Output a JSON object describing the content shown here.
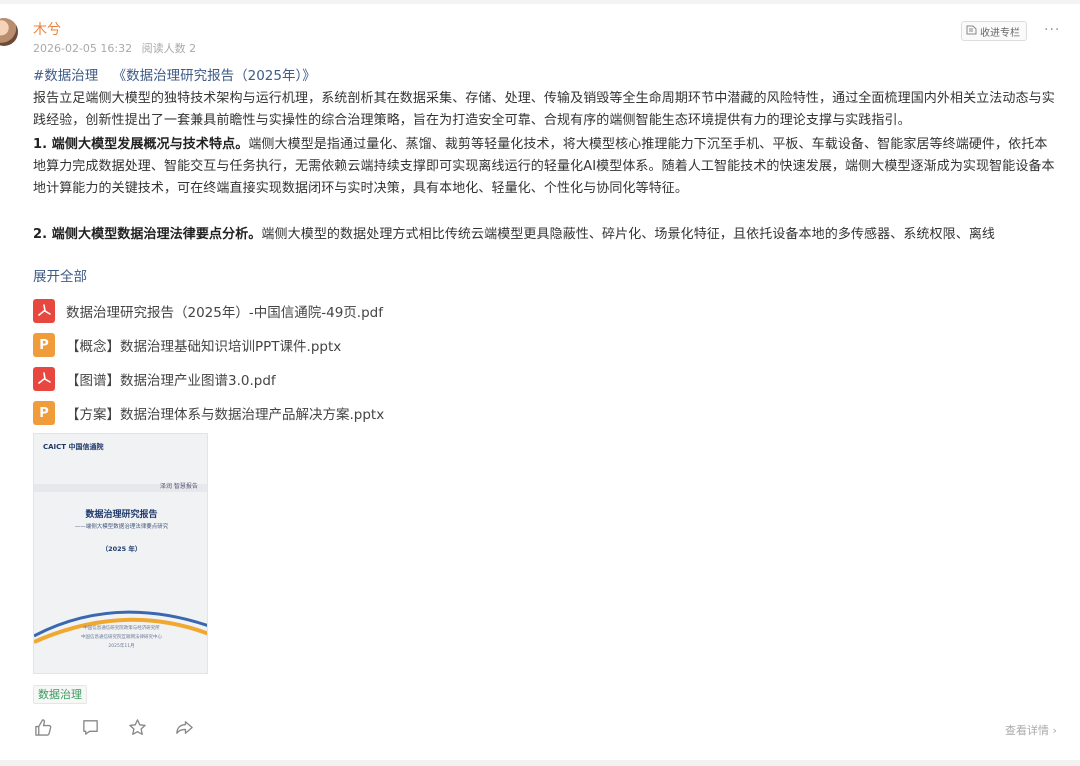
{
  "post": {
    "author": "木兮",
    "datetime": "2026-02-05 16:32",
    "read_count": "阅读人数 2",
    "collect_label": "收进专栏",
    "more_glyph": "···",
    "hashtag": "#数据治理",
    "doc_title": "《数据治理研究报告（2025年）》",
    "paragraphs": {
      "p1": "报告立足端侧大模型的独特技术架构与运行机理，系统剖析其在数据采集、存储、处理、传输及销毁等全生命周期环节中潜藏的风险特性，通过全面梳理国内外相关立法动态与实践经验，创新性提出了一套兼具前瞻性与实操性的综合治理策略，旨在为打造安全可靠、合规有序的端侧智能生态环境提供有力的理论支撑与实践指引。",
      "p2_head": "1. 端侧大模型发展概况与技术特点。",
      "p2_body": "端侧大模型是指通过量化、蒸馏、裁剪等轻量化技术，将大模型核心推理能力下沉至手机、平板、车载设备、智能家居等终端硬件，依托本地算力完成数据处理、智能交互与任务执行，无需依赖云端持续支撑即可实现离线运行的轻量化AI模型体系。随着人工智能技术的快速发展，端侧大模型逐渐成为实现智能设备本地计算能力的关键技术，可在终端直接实现数据闭环与实时决策，具有本地化、轻量化、个性化与协同化等特征。",
      "p3_head": "2. 端侧大模型数据治理法律要点分析。",
      "p3_body": "端侧大模型的数据处理方式相比传统云端模型更具隐蔽性、碎片化、场景化特征，且依托设备本地的多传感器、系统权限、离线"
    },
    "expand_label": "展开全部",
    "files": [
      {
        "type": "pdf",
        "name": "数据治理研究报告（2025年）-中国信通院-49页.pdf"
      },
      {
        "type": "ppt",
        "name": "【概念】数据治理基础知识培训PPT课件.pptx"
      },
      {
        "type": "pdf",
        "name": "【图谱】数据治理产业图谱3.0.pdf"
      },
      {
        "type": "ppt",
        "name": "【方案】数据治理体系与数据治理产品解决方案.pptx"
      }
    ],
    "ppt_glyph": "P",
    "cover": {
      "logo": "CAICT 中国信通院",
      "brand": "泽润 智慧报告",
      "title": "数据治理研究报告",
      "subtitle": "——端侧大模型数据治理法律要点研究",
      "year": "（2025 年）",
      "orgs": [
        "中国信息通信研究院政策与经济研究所",
        "中国信息通信研究院互联网法律研究中心",
        "2025年11月"
      ]
    },
    "tag": "数据治理",
    "detail_label": "查看详情 ›"
  },
  "icons": {
    "collect": "collect-icon",
    "like": "thumbs-up-icon",
    "comment": "comment-icon",
    "favorite": "star-icon",
    "share": "share-icon"
  },
  "colors": {
    "author": "#e8833a",
    "link": "#3f5b86",
    "pdf": "#e8473f",
    "ppt": "#f19c3a",
    "tag": "#3c9a5f"
  }
}
